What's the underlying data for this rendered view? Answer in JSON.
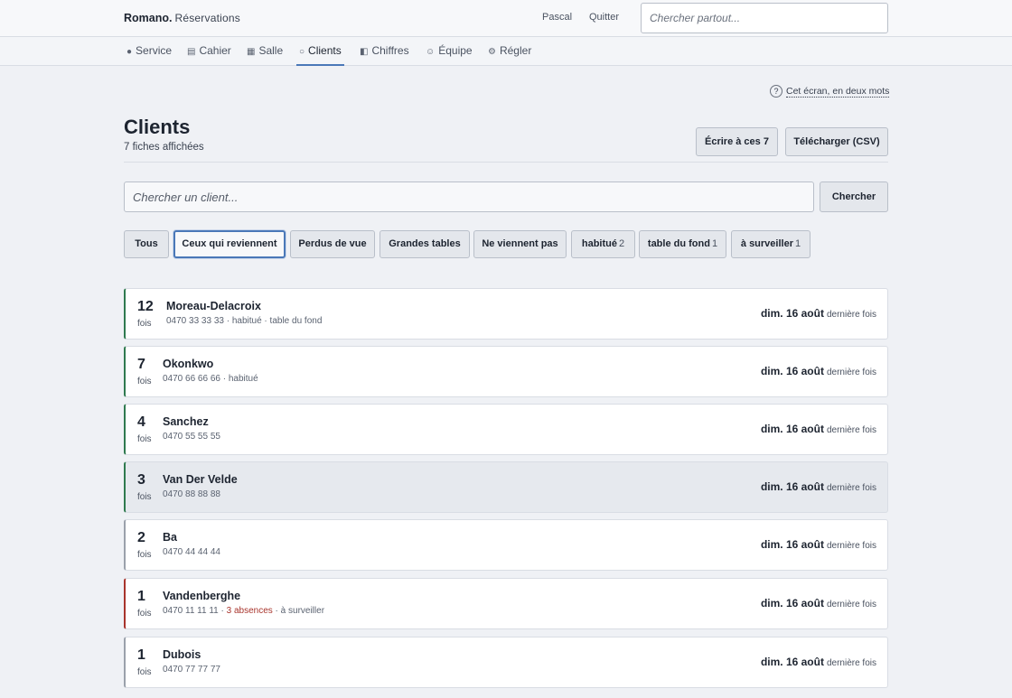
{
  "header": {
    "brand": "Romano.",
    "subtitle": "Réservations",
    "user": "Pascal",
    "quit": "Quitter",
    "search_placeholder": "Chercher partout..."
  },
  "nav": [
    {
      "icon": "●",
      "label": "Service"
    },
    {
      "icon": "▤",
      "label": "Cahier"
    },
    {
      "icon": "▦",
      "label": "Salle"
    },
    {
      "icon": "○",
      "label": "Clients"
    },
    {
      "icon": "◧",
      "label": "Chiffres"
    },
    {
      "icon": "☺",
      "label": "Équipe"
    },
    {
      "icon": "⚙",
      "label": "Régler"
    }
  ],
  "nav_active": "Clients",
  "help": {
    "icon": "?",
    "label": "Cet écran, en deux mots"
  },
  "page": {
    "title": "Clients",
    "count": "7 fiches affichées",
    "write_button": "Écrire à ces 7",
    "download_button": "Télécharger (CSV)"
  },
  "search": {
    "placeholder": "Chercher un client...",
    "button": "Chercher"
  },
  "filters": [
    {
      "label": "Tous",
      "count": ""
    },
    {
      "label": "Ceux qui reviennent",
      "count": ""
    },
    {
      "label": "Perdus de vue",
      "count": ""
    },
    {
      "label": "Grandes tables",
      "count": ""
    },
    {
      "label": "Ne viennent pas",
      "count": ""
    },
    {
      "label": "habitué",
      "count": "2"
    },
    {
      "label": "table du fond",
      "count": "1"
    },
    {
      "label": "à surveiller",
      "count": "1"
    }
  ],
  "filter_active": "Ceux qui reviennent",
  "clients": [
    {
      "count": "12",
      "unit": "fois",
      "name": "Moreau-Delacroix",
      "phone": "0470 33 33 33",
      "tags": [
        "habitué",
        "table du fond"
      ],
      "warning": "",
      "date": "dim. 16 août",
      "date_suffix": "dernière fois",
      "accent": "#2f7a4f"
    },
    {
      "count": "7",
      "unit": "fois",
      "name": "Okonkwo",
      "phone": "0470 66 66 66",
      "tags": [
        "habitué"
      ],
      "warning": "",
      "date": "dim. 16 août",
      "date_suffix": "dernière fois",
      "accent": "#2f7a4f"
    },
    {
      "count": "4",
      "unit": "fois",
      "name": "Sanchez",
      "phone": "0470 55 55 55",
      "tags": [],
      "warning": "",
      "date": "dim. 16 août",
      "date_suffix": "dernière fois",
      "accent": "#2f7a4f"
    },
    {
      "count": "3",
      "unit": "fois",
      "name": "Van Der Velde",
      "phone": "0470 88 88 88",
      "tags": [],
      "warning": "",
      "date": "dim. 16 août",
      "date_suffix": "dernière fois",
      "accent": "#2f7a4f"
    },
    {
      "count": "2",
      "unit": "fois",
      "name": "Ba",
      "phone": "0470 44 44 44",
      "tags": [],
      "warning": "",
      "date": "dim. 16 août",
      "date_suffix": "dernière fois",
      "accent": "#9aa1ab"
    },
    {
      "count": "1",
      "unit": "fois",
      "name": "Vandenberghe",
      "phone": "0470 11 11 11",
      "tags": [
        "à surveiller"
      ],
      "warning": "3 absences",
      "date": "dim. 16 août",
      "date_suffix": "dernière fois",
      "accent": "#a8342c"
    },
    {
      "count": "1",
      "unit": "fois",
      "name": "Dubois",
      "phone": "0470 77 77 77",
      "tags": [],
      "warning": "",
      "date": "dim. 16 août",
      "date_suffix": "dernière fois",
      "accent": "#9aa1ab"
    }
  ],
  "colors": {
    "accent": "#4a78b8",
    "returning": "#2f7a4f",
    "warning": "#a8342c",
    "neutral": "#9aa1ab"
  }
}
